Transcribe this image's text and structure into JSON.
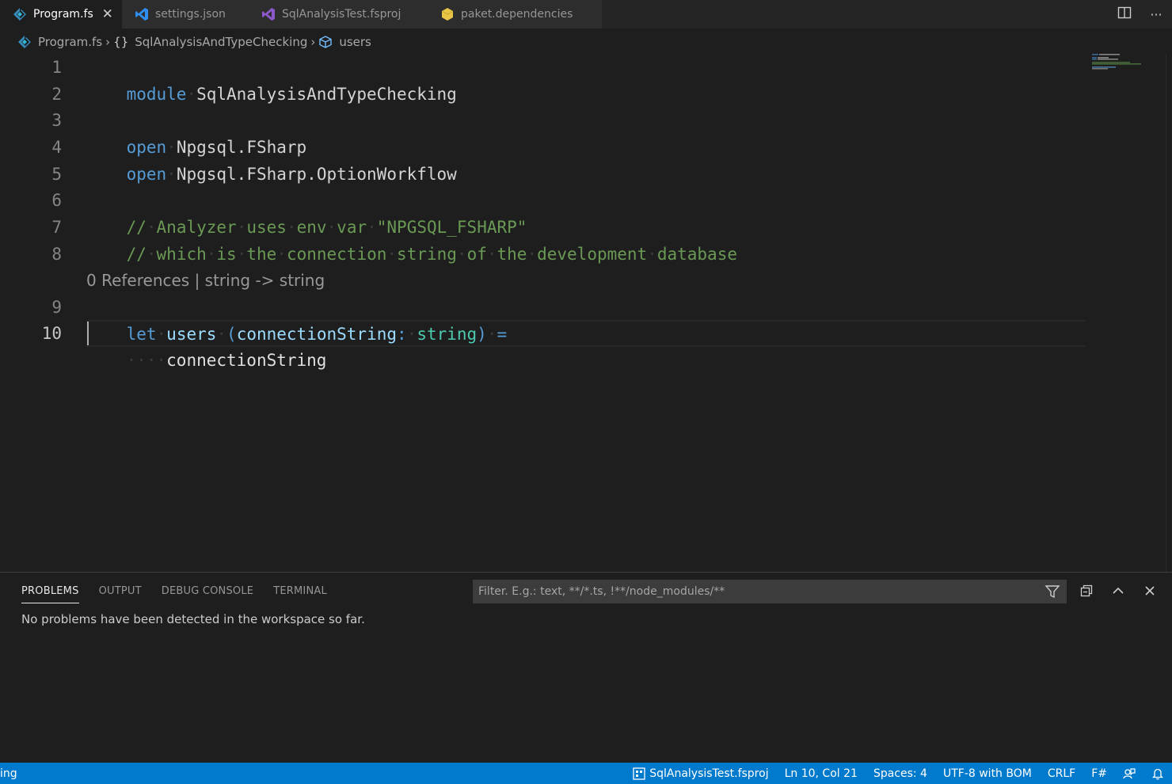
{
  "tabs": [
    {
      "label": "Program.fs",
      "icon": "fsharp-icon",
      "active": true
    },
    {
      "label": "settings.json",
      "icon": "vscode-icon"
    },
    {
      "label": "SqlAnalysisTest.fsproj",
      "icon": "visual-studio-icon"
    },
    {
      "label": "paket.dependencies",
      "icon": "paket-icon"
    }
  ],
  "breadcrumb": {
    "file": "Program.fs",
    "module": "SqlAnalysisAndTypeChecking",
    "symbol": "users"
  },
  "editor": {
    "line_numbers": [
      "1",
      "2",
      "3",
      "4",
      "5",
      "6",
      "7",
      "8",
      "9",
      "10"
    ],
    "code": {
      "l1_kw": "module",
      "l1_id": "SqlAnalysisAndTypeChecking",
      "l3_kw": "open",
      "l3_id": "Npgsql.FSharp",
      "l4_kw": "open",
      "l4_id": "Npgsql.FSharp.OptionWorkflow",
      "l6_comment": "// Analyzer uses env var \"NPGSQL_FSHARP\"",
      "l7_comment": "// which is the connection string of the development database",
      "l9_kw": "let",
      "l9_fn": "users",
      "l9_open": "(",
      "l9_param": "connectionString",
      "l9_colon": ":",
      "l9_type": "string",
      "l9_close": ")",
      "l9_eq": "=",
      "l10_id": "connectionString"
    },
    "codelens": "0 References | string -> string"
  },
  "panel": {
    "tabs": [
      "PROBLEMS",
      "OUTPUT",
      "DEBUG CONSOLE",
      "TERMINAL"
    ],
    "filter_placeholder": "Filter. E.g.: text, **/*.ts, !**/node_modules/**",
    "message": "No problems have been detected in the workspace so far."
  },
  "status": {
    "left_text": "ing",
    "project": "SqlAnalysisTest.fsproj",
    "position": "Ln 10, Col 21",
    "spaces": "Spaces: 4",
    "encoding": "UTF-8 with BOM",
    "eol": "CRLF",
    "language": "F#"
  },
  "colors": {
    "editor_bg": "#1e1e1e",
    "status_bg": "#007acc",
    "keyword": "#569cd6",
    "comment": "#6a9955",
    "type": "#4ec9b0",
    "param": "#9cdcfe"
  }
}
